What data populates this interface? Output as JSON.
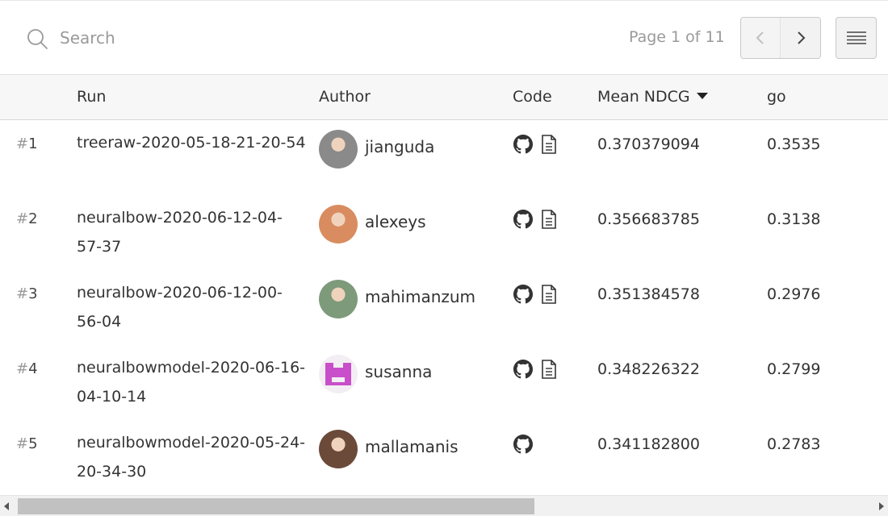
{
  "search": {
    "placeholder": "Search",
    "value": ""
  },
  "pagination": {
    "label": "Page 1 of 11"
  },
  "columns": {
    "run": "Run",
    "author": "Author",
    "code": "Code",
    "mean_ndcg": "Mean NDCG",
    "go": "go"
  },
  "rows": [
    {
      "rank_hash": "#",
      "rank": "1",
      "run": "treeraw-2020-05-18-21-20-54",
      "author": "jianguda",
      "avatar_color": "#8a8a8a",
      "has_github": true,
      "has_doc": true,
      "mean_ndcg": "0.370379094",
      "go": "0.3535"
    },
    {
      "rank_hash": "#",
      "rank": "2",
      "run": "neuralbow-2020-06-12-04-57-37",
      "author": "alexeys",
      "avatar_color": "#d98c5f",
      "has_github": true,
      "has_doc": true,
      "mean_ndcg": "0.356683785",
      "go": "0.3138"
    },
    {
      "rank_hash": "#",
      "rank": "3",
      "run": "neuralbow-2020-06-12-00-56-04",
      "author": "mahimanzum",
      "avatar_color": "#7d9a7a",
      "has_github": true,
      "has_doc": true,
      "mean_ndcg": "0.351384578",
      "go": "0.2976"
    },
    {
      "rank_hash": "#",
      "rank": "4",
      "run": "neuralbowmodel-2020-06-16-04-10-14",
      "author": "susanna",
      "avatar_color": "#c84fc9",
      "has_github": true,
      "has_doc": true,
      "mean_ndcg": "0.348226322",
      "go": "0.2799"
    },
    {
      "rank_hash": "#",
      "rank": "5",
      "run": "neuralbowmodel-2020-05-24-20-34-30",
      "author": "mallamanis",
      "avatar_color": "#6b4a3a",
      "has_github": true,
      "has_doc": false,
      "mean_ndcg": "0.341182800",
      "go": "0.2783"
    }
  ],
  "icons": {
    "search": "search-icon",
    "prev": "chevron-left-icon",
    "next": "chevron-right-icon",
    "menu": "hamburger-menu-icon",
    "github": "github-icon",
    "doc": "document-icon",
    "sort": "sort-desc-icon"
  },
  "colors": {
    "muted_text": "#9a9a9a",
    "header_bg": "#f7f7f7",
    "border": "#d9d9d9"
  }
}
